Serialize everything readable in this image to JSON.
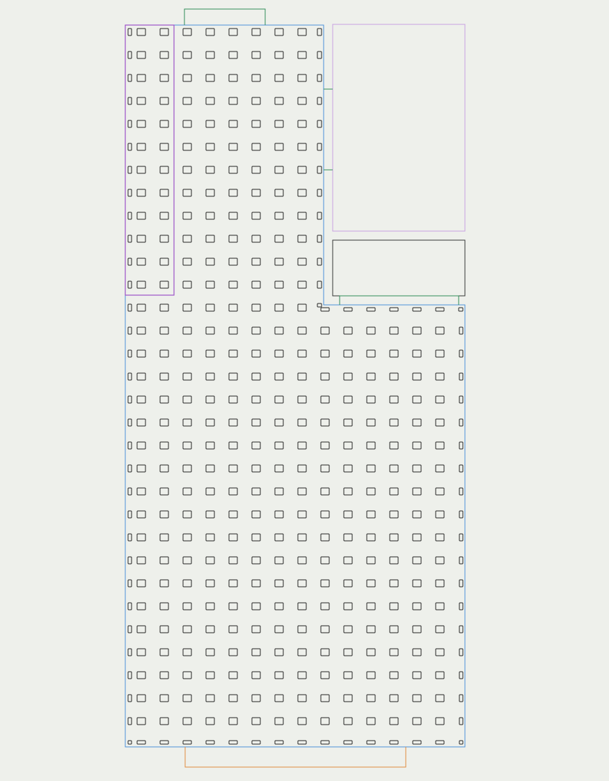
{
  "canvas": {
    "background": "#eef0eb"
  },
  "colors": {
    "grid_outline": "#4a90d9",
    "left_strip": "#9b4fc9",
    "upper_right_panel": "#c8a0e0",
    "lower_right_panel": "#333333",
    "top_tab": "#2e8b57",
    "bottom_tab": "#e08a3c",
    "connector": "#2e8b57",
    "cell_stroke": "#222222"
  },
  "diagram": {
    "description": "",
    "elements": [
      "grid-outline",
      "left-strip-panel",
      "upper-right-panel",
      "lower-right-panel",
      "top-tab",
      "bottom-tab",
      "cell-grid"
    ]
  }
}
